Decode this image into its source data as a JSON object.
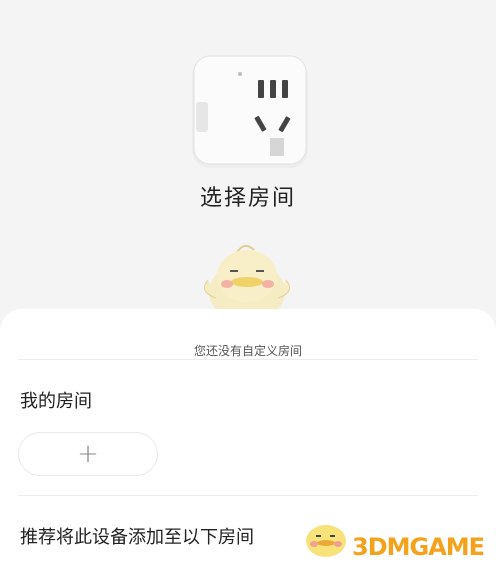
{
  "device": {
    "name": "smart-plug",
    "title": "选择房间"
  },
  "sheet": {
    "empty_hint": "您还没有自定义房间",
    "my_rooms_title": "我的房间",
    "add_label": "+",
    "recommend_title": "推荐将此设备添加至以下房间"
  },
  "watermark": {
    "text": "3DMGAME"
  },
  "colors": {
    "background": "#f4f4f4",
    "sheet": "#ffffff",
    "watermark": "#f4a21b"
  }
}
